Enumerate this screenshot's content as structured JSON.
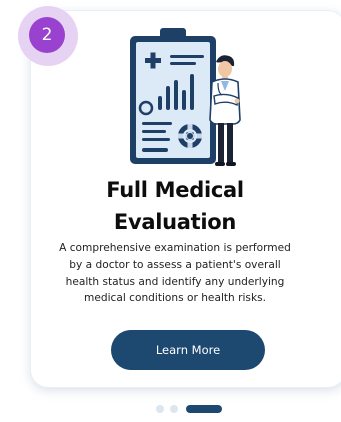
{
  "step": {
    "number": "2"
  },
  "service": {
    "title_line1": "Full Medical",
    "title_line2": "Evaluation",
    "description_line1": "A comprehensive examination is performed",
    "description_line2": "by a doctor to assess a patient's overall",
    "description_line3": "health status and identify any underlying",
    "description_line4": "medical conditions or health risks.",
    "cta_label": "Learn More"
  },
  "carousel": {
    "total_slides": 3,
    "active_slide": 3
  },
  "colors": {
    "badge": "#9a42d0",
    "badge_halo": "#e6d3f4",
    "cta_background": "#1d4870",
    "dot_inactive": "#dde6ef",
    "dot_active": "#1d4870"
  },
  "icons": [
    "clipboard-medical-illustration",
    "doctor-illustration"
  ]
}
